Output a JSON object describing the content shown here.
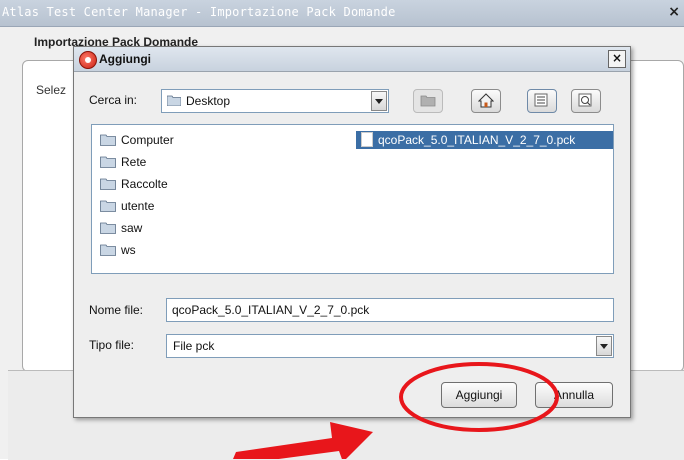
{
  "app": {
    "title": "Atlas Test Center Manager - Importazione Pack Domande",
    "close_glyph": "×",
    "subtitle": "Importazione Pack Domande",
    "select_label": "Selez"
  },
  "dialog": {
    "title": "Aggiungi",
    "close_glyph": "×",
    "look_in_label": "Cerca in:",
    "look_in_value": "Desktop",
    "toolbar_icons": [
      "up-folder-icon",
      "home-icon",
      "list-view-icon",
      "details-view-icon"
    ],
    "folders": [
      {
        "name": "Computer"
      },
      {
        "name": "Rete"
      },
      {
        "name": "Raccolte"
      },
      {
        "name": "utente"
      },
      {
        "name": "saw"
      },
      {
        "name": "ws"
      }
    ],
    "selected_file": "qcoPack_5.0_ITALIAN_V_2_7_0.pck",
    "file_name_label": "Nome file:",
    "file_name_value": "qcoPack_5.0_ITALIAN_V_2_7_0.pck",
    "file_type_label": "Tipo file:",
    "file_type_value": "File pck",
    "add_button": "Aggiungi",
    "cancel_button": "Annulla"
  },
  "annotations": {
    "color": "#e8161b"
  }
}
